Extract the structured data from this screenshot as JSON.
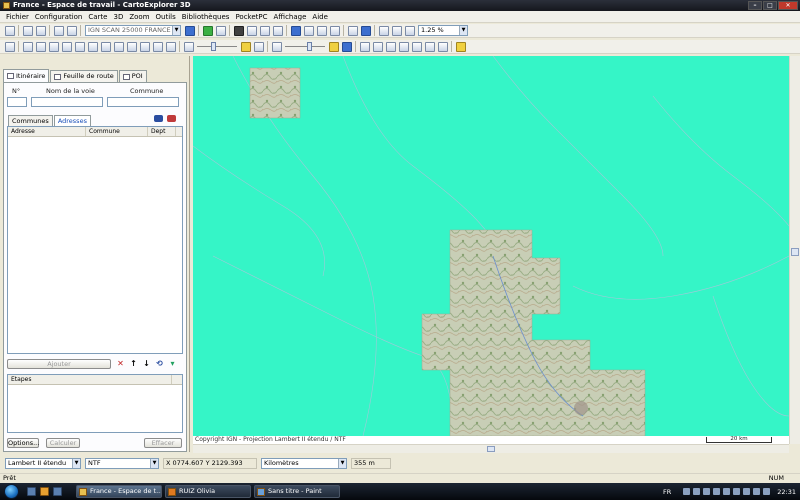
{
  "window": {
    "title": "France - Espace de travail - CartoExplorer 3D"
  },
  "menu": [
    "Fichier",
    "Configuration",
    "Carte",
    "3D",
    "Zoom",
    "Outils",
    "Bibliothèques",
    "PocketPC",
    "Affichage",
    "Aide"
  ],
  "toolbar": {
    "map_combo": "IGN SCAN 25000 FRANCE",
    "zoom_combo": "1.25 %"
  },
  "panel": {
    "tabs": [
      "Itinéraire",
      "Feuille de route",
      "POI"
    ],
    "fields": {
      "number": "N°",
      "street": "Nom de la voie",
      "commune": "Commune"
    },
    "subtabs": [
      "Communes",
      "Adresses"
    ],
    "list_columns": [
      "Adresse",
      "Commune",
      "Dept"
    ],
    "add_button": "Ajouter",
    "steps_header": "Etapes",
    "options_button": "Options...",
    "compute_button": "Calculer",
    "clear_button": "Effacer"
  },
  "map": {
    "copyright": "Copyright IGN - Projection Lambert II étendu / NTF",
    "scale": "20 km"
  },
  "statusbar": {
    "projection": "Lambert II étendu",
    "datum": "NTF",
    "coordinates": "X 0774.607   Y 2129.393",
    "units": "Kilomètres",
    "altitude": "355 m"
  },
  "ready": {
    "text": "Prêt",
    "num": "NUM"
  },
  "taskbar": {
    "tasks": [
      "France - Espace de t...",
      "RUIZ Olivia",
      "Sans titre - Paint"
    ],
    "lang": "FR",
    "clock": "22:31"
  },
  "colors": {
    "map_background": "#35f5c7",
    "title_bar": "#15171d",
    "taskbar": "#05080d"
  }
}
